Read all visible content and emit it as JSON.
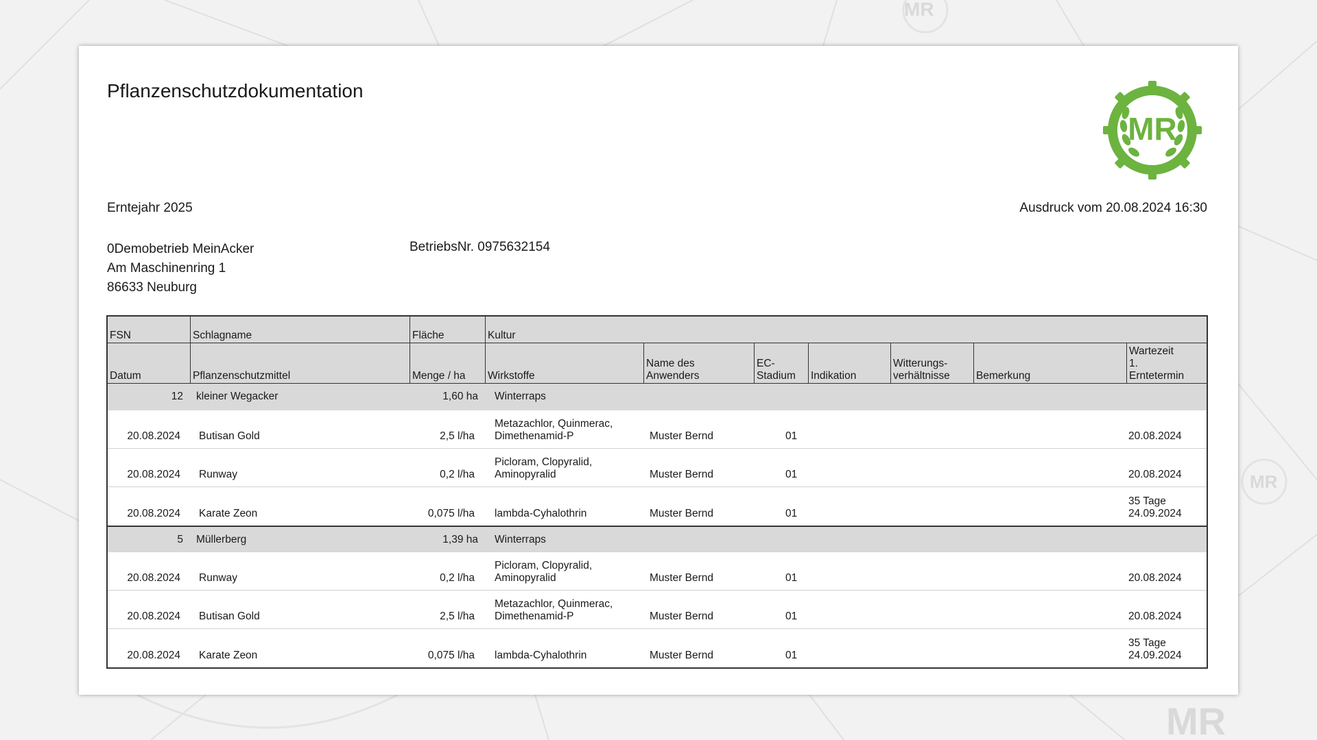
{
  "document": {
    "title": "Pflanzenschutzdokumentation",
    "logo_text": "MR",
    "harvest_year": "Erntejahr 2025",
    "print_date": "Ausdruck vom 20.08.2024 16:30",
    "company": {
      "name": "0Demobetrieb MeinAcker",
      "street": "Am Maschinenring 1",
      "city": "86633 Neuburg",
      "number": "BetriebsNr. 0975632154"
    }
  },
  "table": {
    "header_row1": {
      "fsn": "FSN",
      "field_name": "Schlagname",
      "area": "Fläche",
      "crop": "Kultur"
    },
    "header_row2": {
      "date": "Datum",
      "product": "Pflanzenschutzmittel",
      "rate": "Menge / ha",
      "actives": "Wirkstoffe",
      "applicator": [
        "Name des",
        "Anwenders"
      ],
      "ec_stage": [
        "EC-",
        "Stadium"
      ],
      "indication": "Indikation",
      "weather": [
        "Witterungs-",
        "verhältnisse"
      ],
      "remark": "Bemerkung",
      "waiting": [
        "Wartezeit",
        "1.",
        "Erntetermin"
      ]
    },
    "groups": [
      {
        "fsn": "12",
        "field_name": "kleiner Wegacker",
        "area": "1,60 ha",
        "crop": "Winterraps",
        "entries": [
          {
            "date": "20.08.2024",
            "product": "Butisan Gold",
            "rate": "2,5 l/ha",
            "actives": [
              "Metazachlor, Quinmerac,",
              "Dimethenamid-P"
            ],
            "applicator": "Muster Bernd",
            "ec_stage": "01",
            "indication": "",
            "weather": "",
            "remark": "",
            "waiting": [
              "20.08.2024"
            ]
          },
          {
            "date": "20.08.2024",
            "product": "Runway",
            "rate": "0,2 l/ha",
            "actives": [
              "Picloram, Clopyralid,",
              "Aminopyralid"
            ],
            "applicator": "Muster Bernd",
            "ec_stage": "01",
            "indication": "",
            "weather": "",
            "remark": "",
            "waiting": [
              "20.08.2024"
            ]
          },
          {
            "date": "20.08.2024",
            "product": "Karate Zeon",
            "rate": "0,075 l/ha",
            "actives": [
              "lambda-Cyhalothrin"
            ],
            "applicator": "Muster Bernd",
            "ec_stage": "01",
            "indication": "",
            "weather": "",
            "remark": "",
            "waiting": [
              "35 Tage",
              "24.09.2024"
            ]
          }
        ]
      },
      {
        "fsn": "5",
        "field_name": "Müllerberg",
        "area": "1,39 ha",
        "crop": "Winterraps",
        "entries": [
          {
            "date": "20.08.2024",
            "product": "Runway",
            "rate": "0,2 l/ha",
            "actives": [
              "Picloram, Clopyralid,",
              "Aminopyralid"
            ],
            "applicator": "Muster Bernd",
            "ec_stage": "01",
            "indication": "",
            "weather": "",
            "remark": "",
            "waiting": [
              "20.08.2024"
            ]
          },
          {
            "date": "20.08.2024",
            "product": "Butisan Gold",
            "rate": "2,5 l/ha",
            "actives": [
              "Metazachlor, Quinmerac,",
              "Dimethenamid-P"
            ],
            "applicator": "Muster Bernd",
            "ec_stage": "01",
            "indication": "",
            "weather": "",
            "remark": "",
            "waiting": [
              "20.08.2024"
            ]
          },
          {
            "date": "20.08.2024",
            "product": "Karate Zeon",
            "rate": "0,075 l/ha",
            "actives": [
              "lambda-Cyhalothrin"
            ],
            "applicator": "Muster Bernd",
            "ec_stage": "01",
            "indication": "",
            "weather": "",
            "remark": "",
            "waiting": [
              "35 Tage",
              "24.09.2024"
            ]
          }
        ]
      }
    ]
  },
  "colors": {
    "brand_green": "#6cb33f",
    "header_gray": "#d9d9d9",
    "background": "#f2f2f2"
  }
}
